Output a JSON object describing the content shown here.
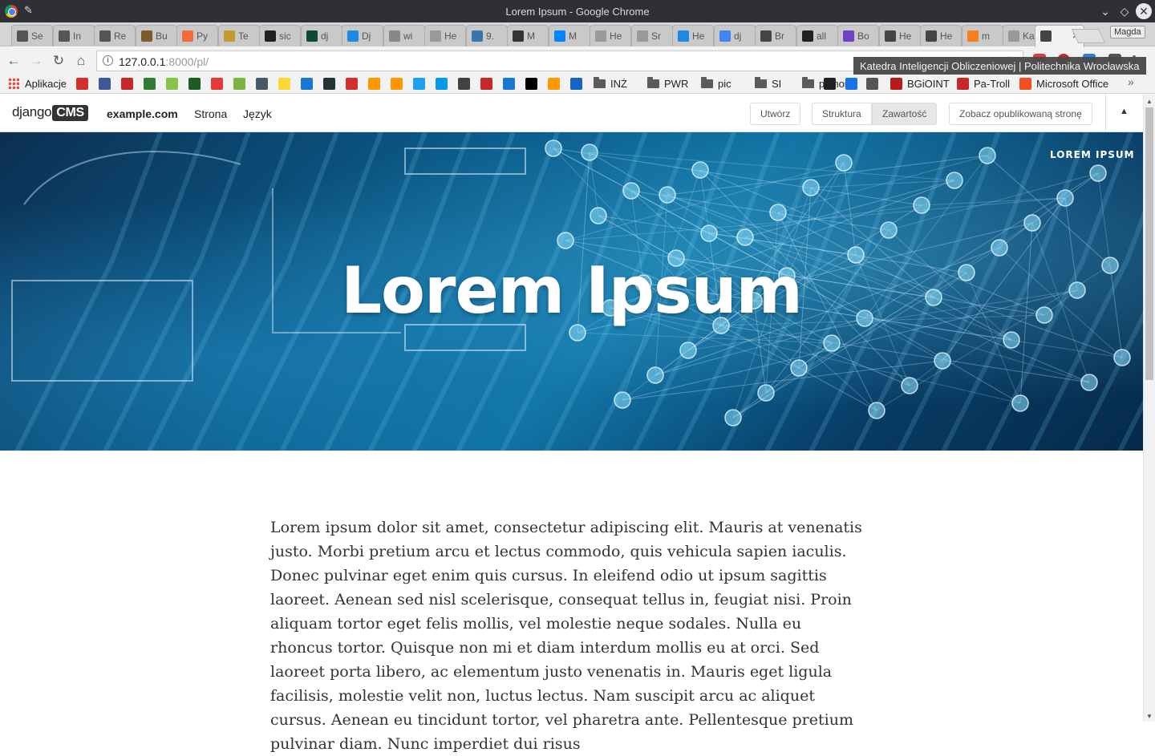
{
  "window": {
    "title": "Lorem Ipsum - Google Chrome"
  },
  "tabs": [
    {
      "label": "Se",
      "color": "#555555"
    },
    {
      "label": "In",
      "color": "#555555"
    },
    {
      "label": "Re",
      "color": "#555555"
    },
    {
      "label": "Bu",
      "color": "#7a5b2e"
    },
    {
      "label": "Py",
      "color": "#f26b3a"
    },
    {
      "label": "Te",
      "color": "#c49a2c"
    },
    {
      "label": "sic",
      "color": "#222222"
    },
    {
      "label": "dj",
      "color": "#0c4b33"
    },
    {
      "label": "Dj",
      "color": "#1e88e5"
    },
    {
      "label": "wi",
      "color": "#888888"
    },
    {
      "label": "He",
      "color": "#999999"
    },
    {
      "label": "9.",
      "color": "#3776ab"
    },
    {
      "label": "M",
      "color": "#333333"
    },
    {
      "label": "M",
      "color": "#0084ff"
    },
    {
      "label": "He",
      "color": "#999999"
    },
    {
      "label": "Sr",
      "color": "#999999"
    },
    {
      "label": "He",
      "color": "#1e88e5"
    },
    {
      "label": "dj",
      "color": "#4285f4"
    },
    {
      "label": "Br",
      "color": "#444444"
    },
    {
      "label": "all",
      "color": "#222222"
    },
    {
      "label": "Bo",
      "color": "#6f42c1"
    },
    {
      "label": "He",
      "color": "#444444"
    },
    {
      "label": "He",
      "color": "#444444"
    },
    {
      "label": "m",
      "color": "#f48024"
    },
    {
      "label": "Ka",
      "color": "#999999"
    }
  ],
  "active_tab": {
    "label": "",
    "close": "×"
  },
  "profile": "Magda",
  "address": {
    "host": "127.0.0.1",
    "rest": ":8000/pl/"
  },
  "tooltip": "Katedra Inteligencji Obliczeniowej | Politechnika Wrocławska",
  "bookmarks": {
    "apps": "Aplikacje",
    "folders": [
      "INŻ",
      "PWR",
      "pic",
      "SI",
      "python"
    ],
    "named": [
      "BGiOINT",
      "Pa-Troll",
      "Microsoft Office"
    ],
    "icon_colors": [
      "#d32f2f",
      "#3b5998",
      "#c62828",
      "#2e7d32",
      "#8bc34a",
      "#1b5e20",
      "#e53935",
      "#7cb342",
      "#455a64",
      "#fdd835",
      "#1976d2",
      "#263238",
      "#d32f2f",
      "#ff9800",
      "#ff9800",
      "#1da1f2",
      "#039be5",
      "#424242",
      "#c62828",
      "#1976d2",
      "#000000",
      "#ff9900",
      "#1565c0"
    ]
  },
  "cms": {
    "logo_text": "django",
    "logo_box": "CMS",
    "menu": [
      "example.com",
      "Strona",
      "Język"
    ],
    "buttons": {
      "create": "Utwórz",
      "structure": "Struktura",
      "content": "Zawartość",
      "view_published": "Zobacz opublikowaną stronę"
    },
    "collapse": "▲"
  },
  "hero": {
    "title": "Lorem Ipsum",
    "brand": "LOREM IPSUM"
  },
  "content": {
    "paragraph": "Lorem ipsum dolor sit amet, consectetur adipiscing elit. Mauris at venenatis justo. Morbi pretium arcu et lectus commodo, quis vehicula sapien iaculis. Donec pulvinar eget enim quis cursus. In eleifend odio ut ipsum sagittis laoreet. Aenean sed nisl scelerisque, consequat tellus in, feugiat nisi. Proin aliquam tortor eget felis mollis, vel molestie neque sodales. Nulla eu rhoncus tortor. Quisque non mi et diam interdum mollis eu at orci. Sed laoreet porta libero, ac elementum justo venenatis in. Mauris eget ligula facilisis, molestie velit non, luctus lectus. Nam suscipit arcu ac aliquet cursus. Aenean eu tincidunt tortor, vel pharetra ante. Pellentesque pretium pulvinar diam. Nunc imperdiet dui risus"
  }
}
